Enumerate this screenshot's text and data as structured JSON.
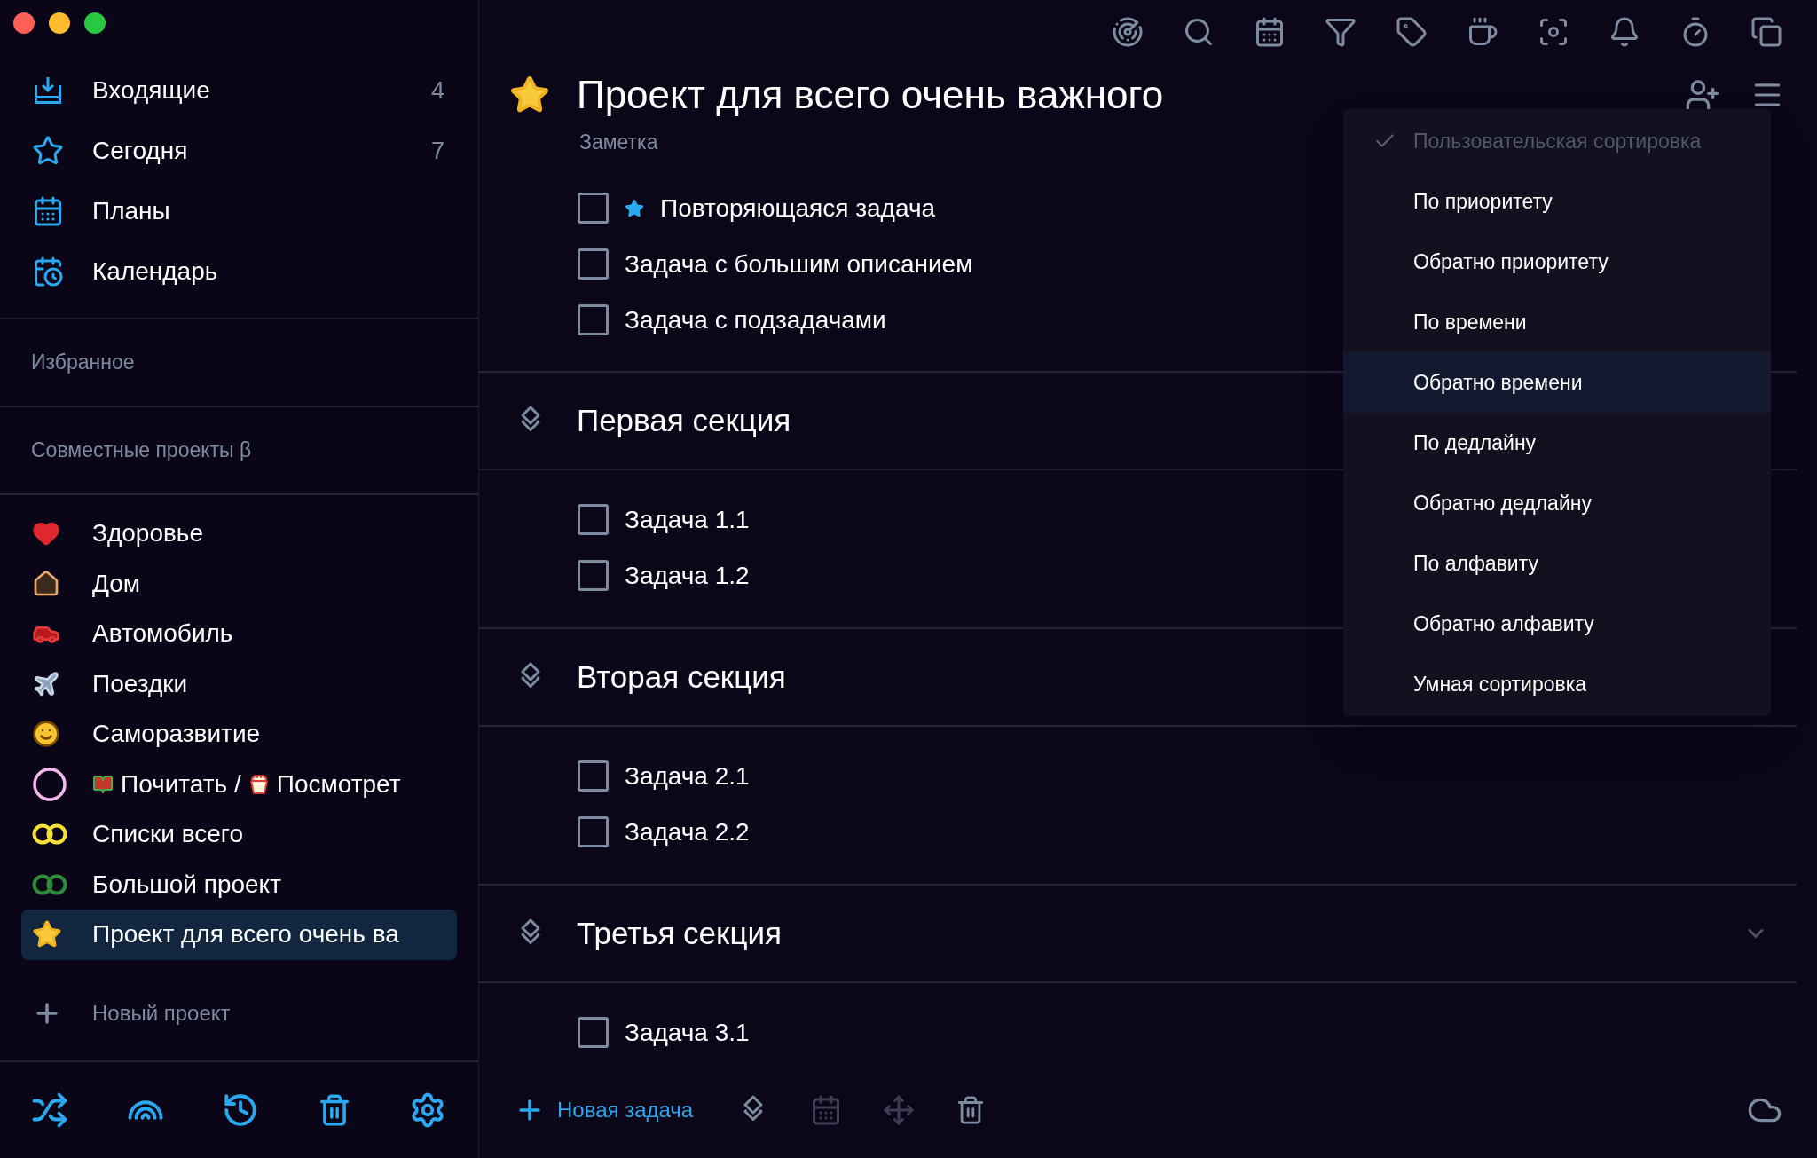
{
  "sidebar": {
    "nav": [
      {
        "kind": "inbox",
        "label": "Входящие",
        "count": "4"
      },
      {
        "kind": "star",
        "label": "Сегодня",
        "count": "7"
      },
      {
        "kind": "calendar",
        "label": "Планы"
      },
      {
        "kind": "calendar-clock",
        "label": "Календарь"
      }
    ],
    "sections": [
      "Избранное",
      "Совместные проекты β"
    ],
    "projects": [
      {
        "kind": "heart",
        "label": "Здоровье",
        "selected": false
      },
      {
        "kind": "house",
        "label": "Дом",
        "selected": false
      },
      {
        "kind": "car",
        "label": "Автомобиль",
        "selected": false
      },
      {
        "kind": "plane",
        "label": "Поездки",
        "selected": false
      },
      {
        "kind": "face",
        "label": "Саморазвитие",
        "selected": false
      },
      {
        "kind": "circle",
        "color": "#f4b8ee",
        "segments": [
          {
            "kind": "books",
            "text": "Почитать /"
          },
          {
            "kind": "popcorn",
            "text": "Посмотрет"
          }
        ],
        "selected": false
      },
      {
        "kind": "rings",
        "color": "#f5e132",
        "label": "Списки всего",
        "selected": false
      },
      {
        "kind": "rings",
        "color": "#2e8b3a",
        "label": "Большой проект",
        "selected": false
      },
      {
        "kind": "star",
        "label": "Проект для всего очень ва",
        "selected": true
      }
    ],
    "new_project": "Новый проект"
  },
  "project": {
    "title": "Проект для всего очень важного",
    "note": "Заметка",
    "tasks": [
      {
        "label": "Повторяющаяся задача",
        "checked": false,
        "starred": true
      },
      {
        "label": "Задача с большим описанием",
        "checked": false,
        "starred": false
      },
      {
        "label": "Задача с подзадачами",
        "checked": false,
        "starred": false
      }
    ],
    "sections": [
      {
        "title": "Первая секция",
        "tasks": [
          {
            "label": "Задача 1.1",
            "checked": false,
            "starred": false
          },
          {
            "label": "Задача 1.2",
            "checked": false,
            "starred": false
          }
        ]
      },
      {
        "title": "Вторая секция",
        "tasks": [
          {
            "label": "Задача 2.1",
            "checked": false,
            "starred": false
          },
          {
            "label": "Задача 2.2",
            "checked": false,
            "starred": false
          }
        ]
      },
      {
        "title": "Третья секция",
        "hovered": true,
        "tasks": [
          {
            "label": "Задача 3.1",
            "checked": false,
            "starred": false
          }
        ]
      }
    ]
  },
  "sort_menu": {
    "items": [
      {
        "label": "Пользовательская сортировка",
        "selected": true,
        "highlighted": false
      },
      {
        "label": "По приоритету",
        "selected": false,
        "highlighted": false
      },
      {
        "label": "Обратно приоритету",
        "selected": false,
        "highlighted": false
      },
      {
        "label": "По времени",
        "selected": false,
        "highlighted": false
      },
      {
        "label": "Обратно времени",
        "selected": false,
        "highlighted": true
      },
      {
        "label": "По дедлайну",
        "selected": false,
        "highlighted": false
      },
      {
        "label": "Обратно дедлайну",
        "selected": false,
        "highlighted": false
      },
      {
        "label": "По алфавиту",
        "selected": false,
        "highlighted": false
      },
      {
        "label": "Обратно алфавиту",
        "selected": false,
        "highlighted": false
      },
      {
        "label": "Умная сортировка",
        "selected": false,
        "highlighted": false
      }
    ]
  },
  "bottom_bar": {
    "new_task": "Новая задача",
    "tools": [
      {
        "kind": "layers",
        "disabled": false
      },
      {
        "kind": "calendar",
        "disabled": true
      },
      {
        "kind": "move",
        "disabled": true
      },
      {
        "kind": "trash",
        "disabled": false
      }
    ]
  }
}
